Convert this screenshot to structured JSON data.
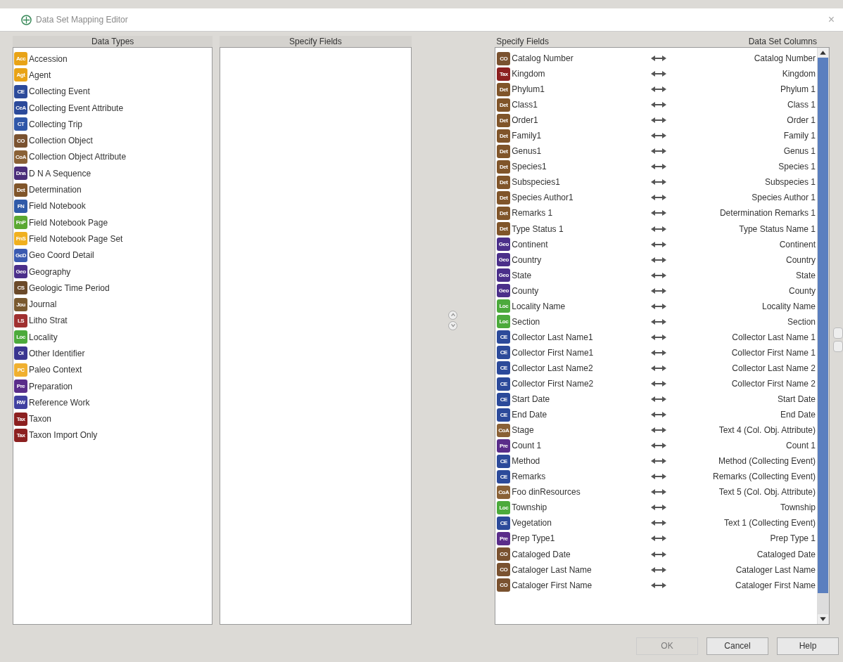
{
  "window": {
    "title": "Data Set Mapping Editor",
    "close": "×"
  },
  "data_types": {
    "header": "Data Types",
    "items": [
      {
        "badge": "Acc",
        "color": "#e8a317",
        "label": "Accession"
      },
      {
        "badge": "Agt",
        "color": "#e8a317",
        "label": "Agent"
      },
      {
        "badge": "CE",
        "color": "#2c4a9a",
        "label": "Collecting Event"
      },
      {
        "badge": "CeA",
        "color": "#2c4a9a",
        "label": "Collecting Event Attribute"
      },
      {
        "badge": "CT",
        "color": "#3057a8",
        "label": "Collecting Trip"
      },
      {
        "badge": "CO",
        "color": "#7a5230",
        "label": "Collection Object"
      },
      {
        "badge": "CoA",
        "color": "#8a6136",
        "label": "Collection Object Attribute"
      },
      {
        "badge": "Dna",
        "color": "#4a2d7a",
        "label": "D N A Sequence"
      },
      {
        "badge": "Det",
        "color": "#80552a",
        "label": "Determination"
      },
      {
        "badge": "FN",
        "color": "#2f5aa8",
        "label": "Field Notebook"
      },
      {
        "badge": "FnP",
        "color": "#5aa832",
        "label": "Field Notebook Page"
      },
      {
        "badge": "FnS",
        "color": "#f0b020",
        "label": "Field Notebook Page Set"
      },
      {
        "badge": "GcD",
        "color": "#3a5ab0",
        "label": "Geo Coord Detail"
      },
      {
        "badge": "Geo",
        "color": "#4b2f8a",
        "label": "Geography"
      },
      {
        "badge": "CS",
        "color": "#6b4a2a",
        "label": "Geologic Time Period"
      },
      {
        "badge": "Jou",
        "color": "#7a5a30",
        "label": "Journal"
      },
      {
        "badge": "LS",
        "color": "#a03030",
        "label": "Litho Strat"
      },
      {
        "badge": "Loc",
        "color": "#4caa3c",
        "label": "Locality"
      },
      {
        "badge": "OI",
        "color": "#3a3590",
        "label": "Other Identifier"
      },
      {
        "badge": "PC",
        "color": "#f0b030",
        "label": "Paleo Context"
      },
      {
        "badge": "Pre",
        "color": "#5a2d8a",
        "label": "Preparation"
      },
      {
        "badge": "RW",
        "color": "#4040a0",
        "label": "Reference Work"
      },
      {
        "badge": "Tax",
        "color": "#8c2020",
        "label": "Taxon"
      },
      {
        "badge": "Tax",
        "color": "#8c2020",
        "label": "Taxon Import Only"
      }
    ]
  },
  "specify_fields": {
    "header": "Specify Fields"
  },
  "mappings": {
    "fields_header": "Specify Fields",
    "columns_header": "Data Set Columns",
    "rows": [
      {
        "badge": "CO",
        "color": "#7a5230",
        "field": "Catalog Number",
        "column": "Catalog Number"
      },
      {
        "badge": "Tax",
        "color": "#8c2020",
        "field": "Kingdom",
        "column": "Kingdom"
      },
      {
        "badge": "Det",
        "color": "#80552a",
        "field": "Phylum1",
        "column": "Phylum 1"
      },
      {
        "badge": "Det",
        "color": "#80552a",
        "field": "Class1",
        "column": "Class 1"
      },
      {
        "badge": "Det",
        "color": "#80552a",
        "field": "Order1",
        "column": "Order 1"
      },
      {
        "badge": "Det",
        "color": "#80552a",
        "field": "Family1",
        "column": "Family 1"
      },
      {
        "badge": "Det",
        "color": "#80552a",
        "field": "Genus1",
        "column": "Genus 1"
      },
      {
        "badge": "Det",
        "color": "#80552a",
        "field": "Species1",
        "column": "Species 1"
      },
      {
        "badge": "Det",
        "color": "#80552a",
        "field": "Subspecies1",
        "column": "Subspecies 1"
      },
      {
        "badge": "Det",
        "color": "#80552a",
        "field": "Species Author1",
        "column": "Species Author 1"
      },
      {
        "badge": "Det",
        "color": "#80552a",
        "field": "Remarks 1",
        "column": "Determination Remarks 1"
      },
      {
        "badge": "Det",
        "color": "#80552a",
        "field": "Type Status 1",
        "column": "Type Status Name 1"
      },
      {
        "badge": "Geo",
        "color": "#4b2f8a",
        "field": "Continent",
        "column": "Continent"
      },
      {
        "badge": "Geo",
        "color": "#4b2f8a",
        "field": "Country",
        "column": "Country"
      },
      {
        "badge": "Geo",
        "color": "#4b2f8a",
        "field": "State",
        "column": "State"
      },
      {
        "badge": "Geo",
        "color": "#4b2f8a",
        "field": "County",
        "column": "County"
      },
      {
        "badge": "Loc",
        "color": "#4caa3c",
        "field": "Locality Name",
        "column": "Locality Name"
      },
      {
        "badge": "Loc",
        "color": "#4caa3c",
        "field": "Section",
        "column": "Section"
      },
      {
        "badge": "CE",
        "color": "#2c4a9a",
        "field": "Collector Last Name1",
        "column": "Collector Last Name 1"
      },
      {
        "badge": "CE",
        "color": "#2c4a9a",
        "field": "Collector First Name1",
        "column": "Collector First Name 1"
      },
      {
        "badge": "CE",
        "color": "#2c4a9a",
        "field": "Collector Last Name2",
        "column": "Collector Last Name 2"
      },
      {
        "badge": "CE",
        "color": "#2c4a9a",
        "field": "Collector First Name2",
        "column": "Collector First Name 2"
      },
      {
        "badge": "CE",
        "color": "#2c4a9a",
        "field": "Start Date",
        "column": "Start Date"
      },
      {
        "badge": "CE",
        "color": "#2c4a9a",
        "field": "End Date",
        "column": "End Date"
      },
      {
        "badge": "CoA",
        "color": "#8a6136",
        "field": "Stage",
        "column": "Text 4 (Col. Obj. Attribute)"
      },
      {
        "badge": "Pre",
        "color": "#5a2d8a",
        "field": "Count 1",
        "column": "Count 1"
      },
      {
        "badge": "CE",
        "color": "#2c4a9a",
        "field": "Method",
        "column": "Method (Collecting Event)"
      },
      {
        "badge": "CE",
        "color": "#2c4a9a",
        "field": "Remarks",
        "column": "Remarks (Collecting Event)"
      },
      {
        "badge": "CoA",
        "color": "#8a6136",
        "field": "Foo dinResources",
        "column": "Text 5 (Col. Obj. Attribute)"
      },
      {
        "badge": "Loc",
        "color": "#4caa3c",
        "field": "Township",
        "column": "Township"
      },
      {
        "badge": "CE",
        "color": "#2c4a9a",
        "field": "Vegetation",
        "column": "Text 1 (Collecting Event)"
      },
      {
        "badge": "Pre",
        "color": "#5a2d8a",
        "field": "Prep Type1",
        "column": "Prep Type 1"
      },
      {
        "badge": "CO",
        "color": "#7a5230",
        "field": "Cataloged Date",
        "column": "Cataloged Date"
      },
      {
        "badge": "CO",
        "color": "#7a5230",
        "field": "Cataloger Last Name",
        "column": "Cataloger Last Name"
      },
      {
        "badge": "CO",
        "color": "#7a5230",
        "field": "Cataloger First Name",
        "column": "Cataloger First Name"
      }
    ]
  },
  "buttons": [
    {
      "label": "OK",
      "disabled": true
    },
    {
      "label": "Cancel",
      "disabled": false
    },
    {
      "label": "Help",
      "disabled": false
    }
  ]
}
